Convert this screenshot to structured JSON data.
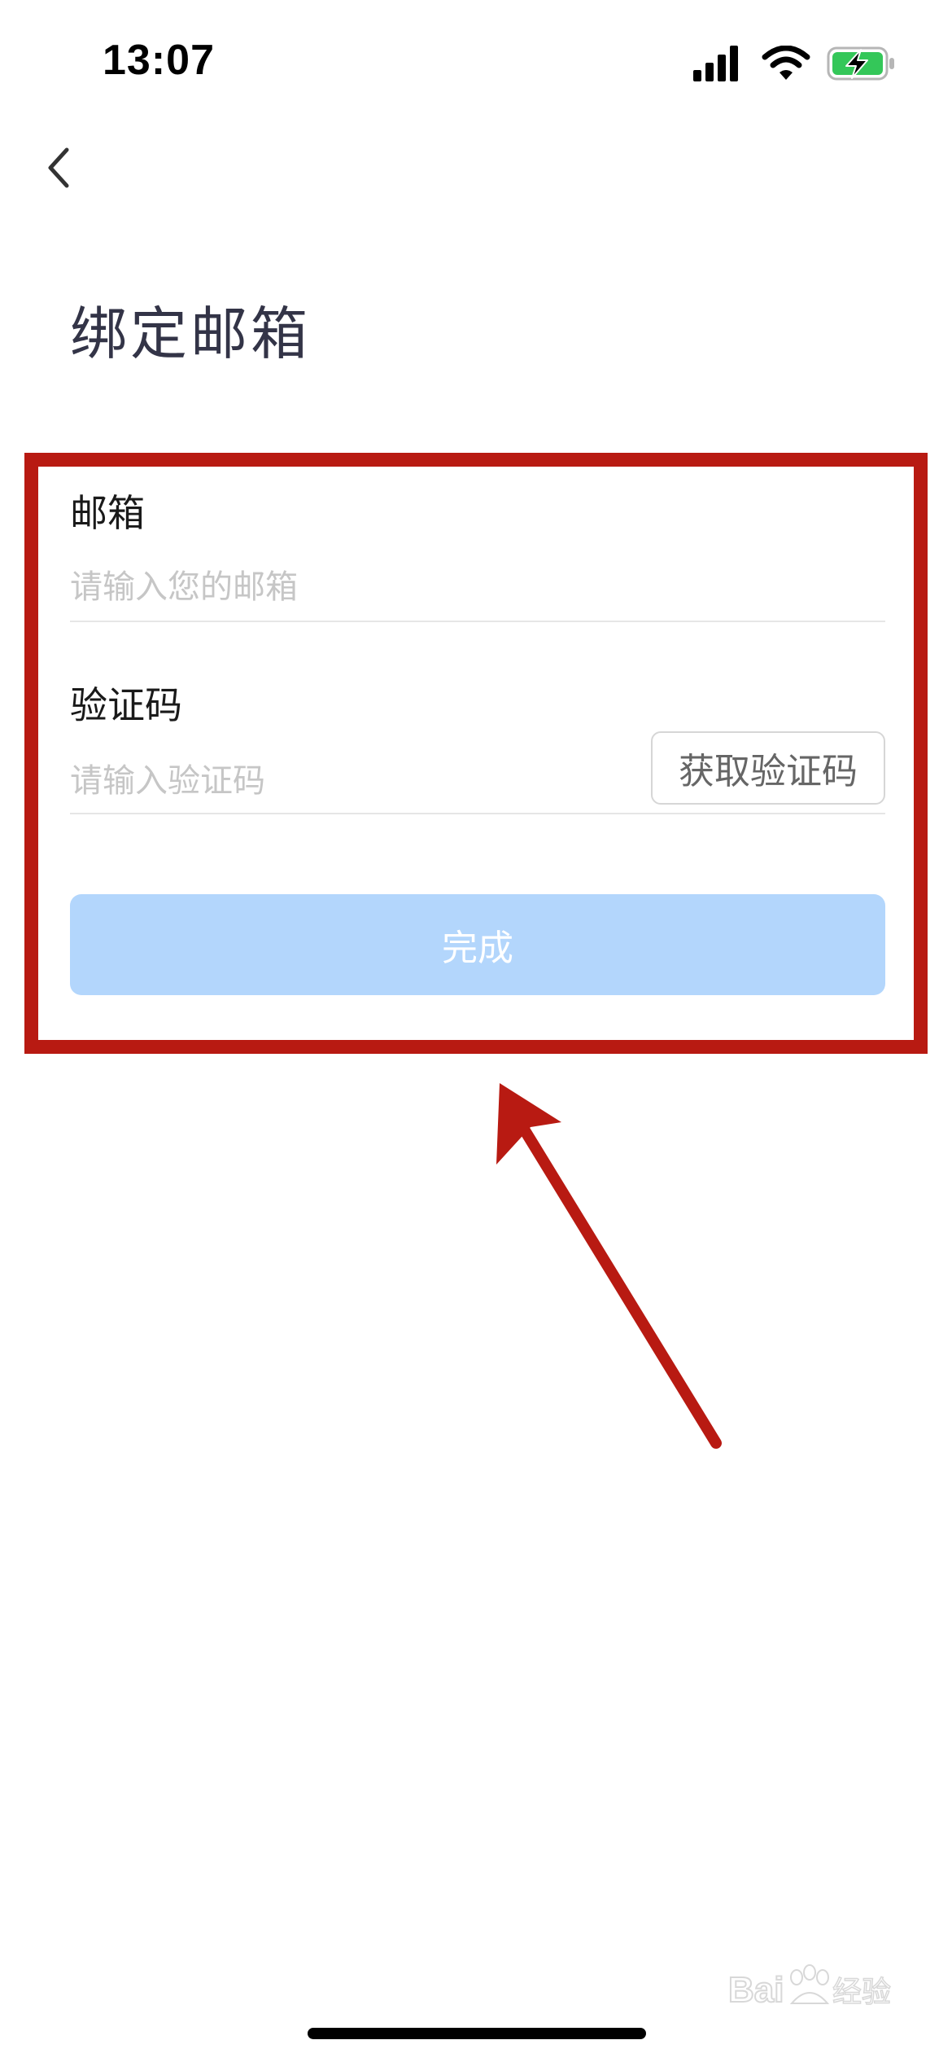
{
  "status_bar": {
    "time": "13:07",
    "icons": [
      "cellular-signal-icon",
      "wifi-icon",
      "battery-charging-icon"
    ],
    "battery_color": "#34c759"
  },
  "nav": {
    "back_icon": "chevron-left-icon"
  },
  "page": {
    "title": "绑定邮箱"
  },
  "form": {
    "email": {
      "label": "邮箱",
      "value": "",
      "placeholder": "请输入您的邮箱"
    },
    "code": {
      "label": "验证码",
      "value": "",
      "placeholder": "请输入验证码",
      "send_button_label": "获取验证码"
    },
    "submit": {
      "label": "完成",
      "color": "#b3d6fc"
    }
  },
  "annotation": {
    "color": "#b81a12"
  },
  "watermark": {
    "text": "Baidu经验"
  }
}
